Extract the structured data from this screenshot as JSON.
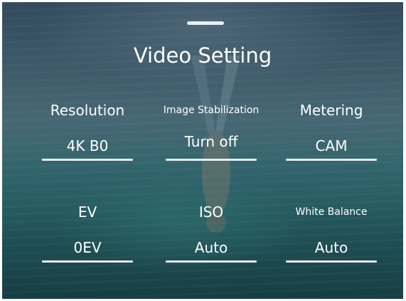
{
  "panel": {
    "title": "Video Setting"
  },
  "settings": [
    {
      "label": "Resolution",
      "value": "4K B0"
    },
    {
      "label": "Image Stabilization",
      "value": "Turn off"
    },
    {
      "label": "Metering",
      "value": "CAM"
    },
    {
      "label": "EV",
      "value": "0EV"
    },
    {
      "label": "ISO",
      "value": "Auto"
    },
    {
      "label": "White Balance",
      "value": "Auto"
    }
  ],
  "colors": {
    "text": "#ffffff",
    "underline": "#e6ecef",
    "water_top": "#3e5a6e",
    "water_bottom": "#18474c"
  }
}
